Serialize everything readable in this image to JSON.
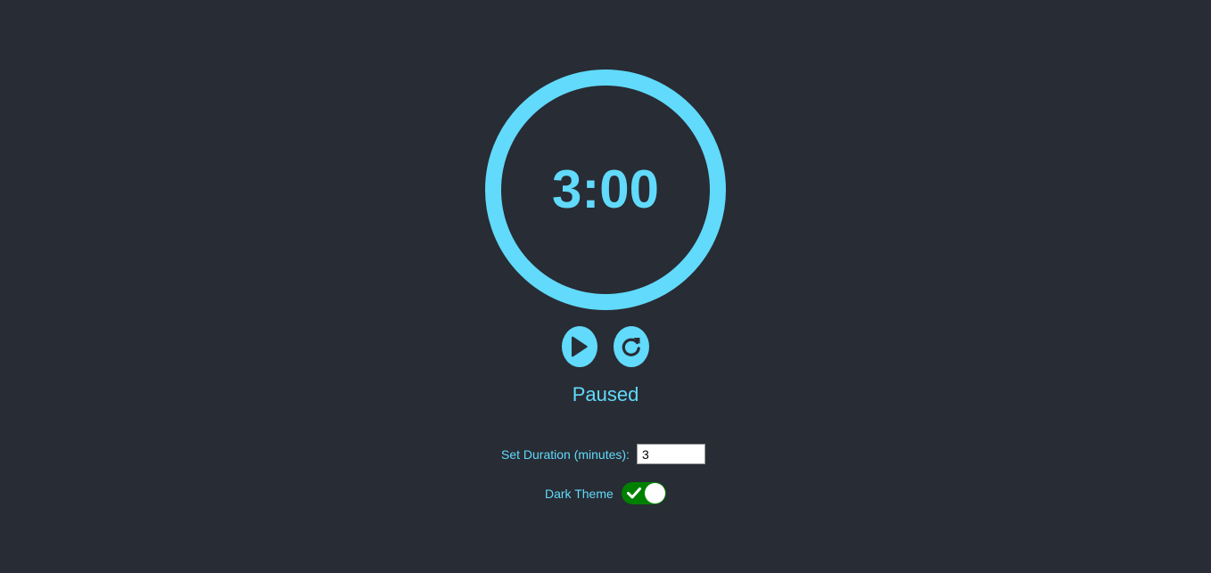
{
  "timer": {
    "display": "3:00"
  },
  "controls": {
    "play_icon": "play-icon",
    "reset_icon": "reset-icon"
  },
  "status": {
    "text": "Paused"
  },
  "settings": {
    "duration_label": "Set Duration (minutes):",
    "duration_value": "3",
    "theme_label": "Dark Theme",
    "dark_theme_enabled": true
  },
  "colors": {
    "background": "#282c34",
    "accent": "#61dafb",
    "toggle_on": "#008000"
  }
}
